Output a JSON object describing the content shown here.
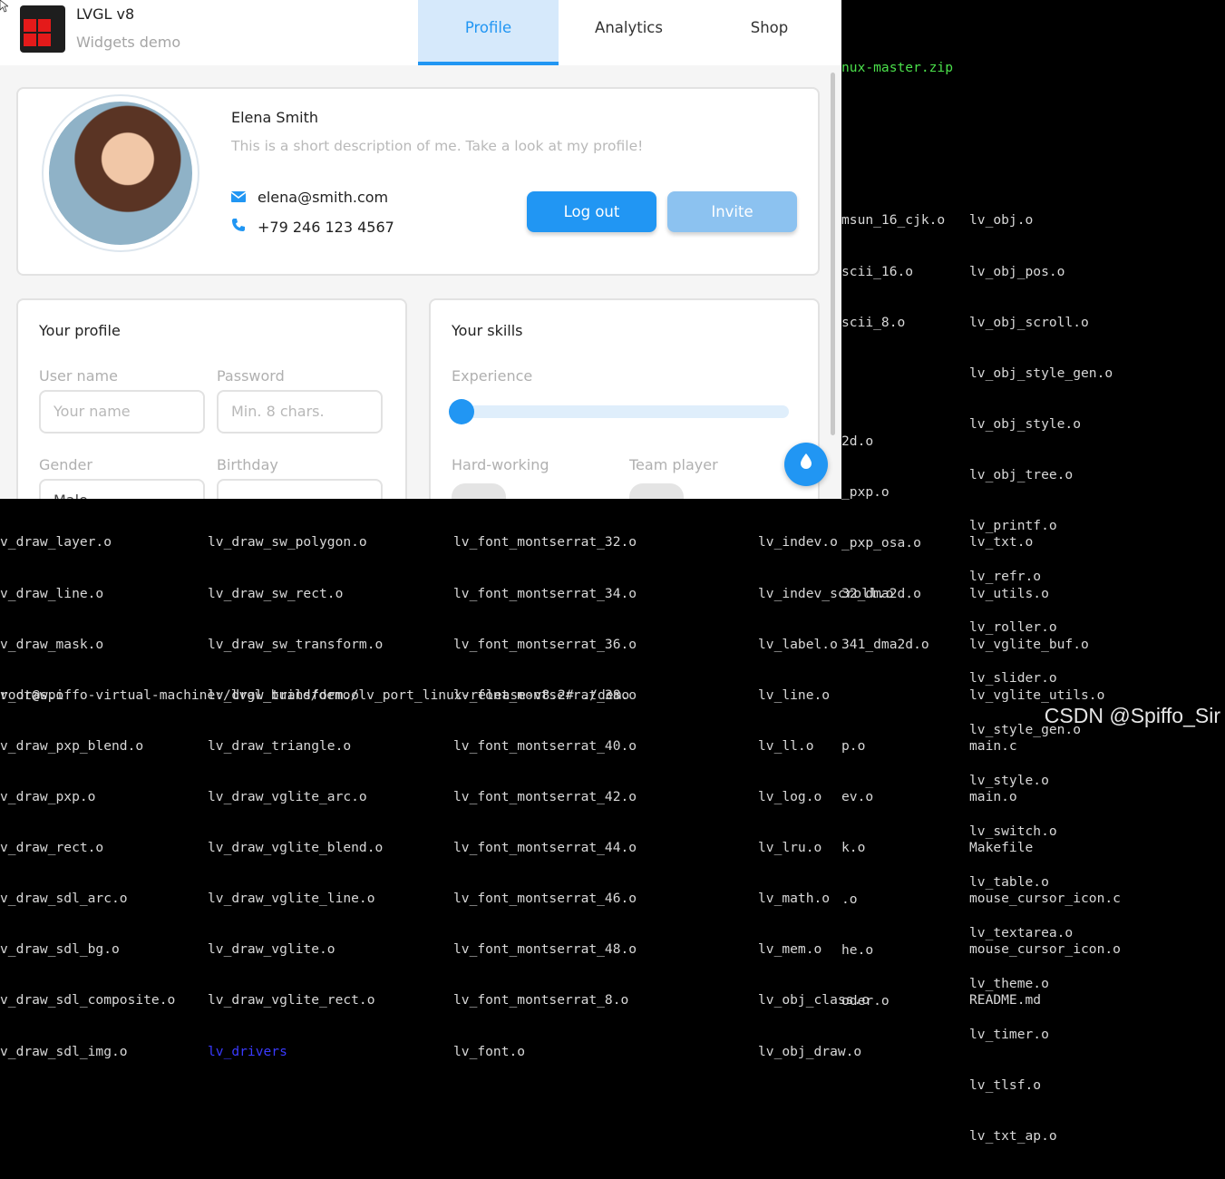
{
  "app": {
    "title": "LVGL v8",
    "subtitle": "Widgets demo",
    "tabs": [
      {
        "label": "Profile",
        "active": true
      },
      {
        "label": "Analytics",
        "active": false
      },
      {
        "label": "Shop",
        "active": false
      }
    ]
  },
  "profile_card": {
    "name": "Elena Smith",
    "description": "This is a short description of me. Take a look at my profile!",
    "email": "elena@smith.com",
    "phone": "+79 246 123 4567",
    "logout_label": "Log out",
    "invite_label": "Invite",
    "email_icon": "envelope-icon",
    "phone_icon": "phone-icon"
  },
  "your_profile": {
    "title": "Your profile",
    "username_label": "User name",
    "username_placeholder": "Your name",
    "password_label": "Password",
    "password_placeholder": "Min. 8 chars.",
    "gender_label": "Gender",
    "gender_value": "Male",
    "birthday_label": "Birthday",
    "birthday_value": ""
  },
  "your_skills": {
    "title": "Your skills",
    "experience_label": "Experience",
    "experience_value": 0,
    "hardworking_label": "Hard-working",
    "hardworking_on": false,
    "teamplayer_label": "Team player",
    "teamplayer_on": false
  },
  "fab_icon": "tint-icon",
  "colors": {
    "accent": "#2196f3",
    "accent_light": "#8cc2f0",
    "tab_active_bg": "#d6e9fb"
  },
  "terminal": {
    "top_zip": "nux-master.zip",
    "top_col1": [
      "msun_16_cjk.o",
      "scii_16.o",
      "scii_8.o",
      "",
      "",
      "2d.o",
      "_pxp.o",
      "_pxp_osa.o",
      "32_dma2d.o",
      "341_dma2d.o",
      "",
      "p.o",
      "ev.o",
      "k.o",
      ".o",
      "he.o",
      "oder.o"
    ],
    "top_col2": [
      "lv_obj.o",
      "lv_obj_pos.o",
      "lv_obj_scroll.o",
      "lv_obj_style_gen.o",
      "lv_obj_style.o",
      "lv_obj_tree.o",
      "lv_printf.o",
      "lv_refr.o",
      "lv_roller.o",
      "lv_slider.o",
      "lv_style_gen.o",
      "lv_style.o",
      "lv_switch.o",
      "lv_table.o",
      "lv_textarea.o",
      "lv_theme.o",
      "lv_timer.o",
      "lv_tlsf.o",
      "lv_txt_ap.o"
    ],
    "bottom_col1": [
      "v_draw_layer.o",
      "v_draw_line.o",
      "v_draw_mask.o",
      "v_draw.o",
      "v_draw_pxp_blend.o",
      "v_draw_pxp.o",
      "v_draw_rect.o",
      "v_draw_sdl_arc.o",
      "v_draw_sdl_bg.o",
      "v_draw_sdl_composite.o",
      "v_draw_sdl_img.o"
    ],
    "bottom_col2": [
      "lv_draw_sw_polygon.o",
      "lv_draw_sw_rect.o",
      "lv_draw_sw_transform.o",
      "lv_draw_transform.o",
      "lv_draw_triangle.o",
      "lv_draw_vglite_arc.o",
      "lv_draw_vglite_blend.o",
      "lv_draw_vglite_line.o",
      "lv_draw_vglite.o",
      "lv_draw_vglite_rect.o"
    ],
    "bottom_col2_dir": "lv_drivers",
    "bottom_col3": [
      "lv_font_montserrat_32.o",
      "lv_font_montserrat_34.o",
      "lv_font_montserrat_36.o",
      "lv_font_montserrat_38.o",
      "lv_font_montserrat_40.o",
      "lv_font_montserrat_42.o",
      "lv_font_montserrat_44.o",
      "lv_font_montserrat_46.o",
      "lv_font_montserrat_48.o",
      "lv_font_montserrat_8.o",
      "lv_font.o"
    ],
    "bottom_col4": [
      "lv_indev.o",
      "lv_indev_scroll.o",
      "lv_label.o",
      "lv_line.o",
      "lv_ll.o",
      "lv_log.o",
      "lv_lru.o",
      "lv_math.o",
      "lv_mem.o",
      "lv_obj_class.o",
      "lv_obj_draw.o"
    ],
    "bottom_col5": [
      "lv_txt.o",
      "lv_utils.o",
      "lv_vglite_buf.o",
      "lv_vglite_utils.o",
      "main.c",
      "main.o",
      "Makefile",
      "mouse_cursor_icon.c",
      "mouse_cursor_icon.o",
      "README.md"
    ],
    "prompt": "root@spiffo-virtual-machine:/lvgl_build/demo/lv_port_linux-release-v8.2# ./demo"
  },
  "watermark": "CSDN @Spiffo_Sir"
}
